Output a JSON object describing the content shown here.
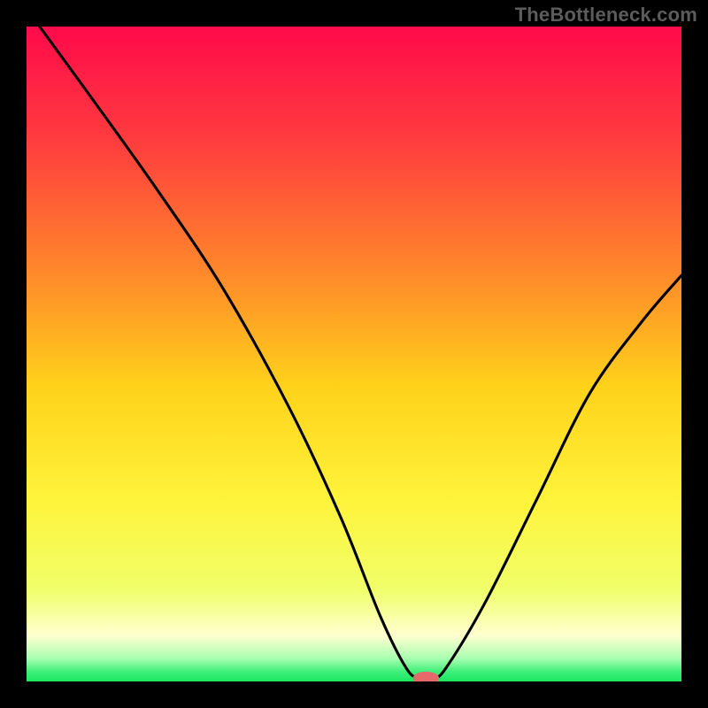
{
  "watermark": "TheBottleneck.com",
  "colors": {
    "page_background": "#000000",
    "watermark_text": "#5c5c5c",
    "curve": "#000000",
    "marker": "#e66a6a",
    "gradient_stops": [
      {
        "offset": 0.0,
        "color": "#ff0a4a"
      },
      {
        "offset": 0.18,
        "color": "#ff3e3e"
      },
      {
        "offset": 0.38,
        "color": "#ff8a2a"
      },
      {
        "offset": 0.55,
        "color": "#ffd21a"
      },
      {
        "offset": 0.72,
        "color": "#fff33a"
      },
      {
        "offset": 0.86,
        "color": "#f0ff6a"
      },
      {
        "offset": 0.93,
        "color": "#ffffd0"
      },
      {
        "offset": 0.965,
        "color": "#a8ffb0"
      },
      {
        "offset": 0.985,
        "color": "#3ff07a"
      },
      {
        "offset": 1.0,
        "color": "#18e860"
      }
    ]
  },
  "chart_data": {
    "type": "line",
    "title": "",
    "xlabel": "",
    "ylabel": "",
    "xlim": [
      0,
      100
    ],
    "ylim": [
      0,
      100
    ],
    "series": [
      {
        "name": "bottleneck-curve",
        "x": [
          2,
          10,
          20,
          30,
          40,
          48,
          54,
          58,
          60,
          62,
          64,
          70,
          78,
          86,
          94,
          100
        ],
        "y": [
          100,
          89,
          75,
          60,
          42,
          25,
          10,
          2,
          0.5,
          0.5,
          2,
          12,
          28,
          44,
          55,
          62
        ]
      }
    ],
    "marker": {
      "x": 61,
      "y": 0.5,
      "rx": 2.0,
      "ry": 1.0
    }
  }
}
